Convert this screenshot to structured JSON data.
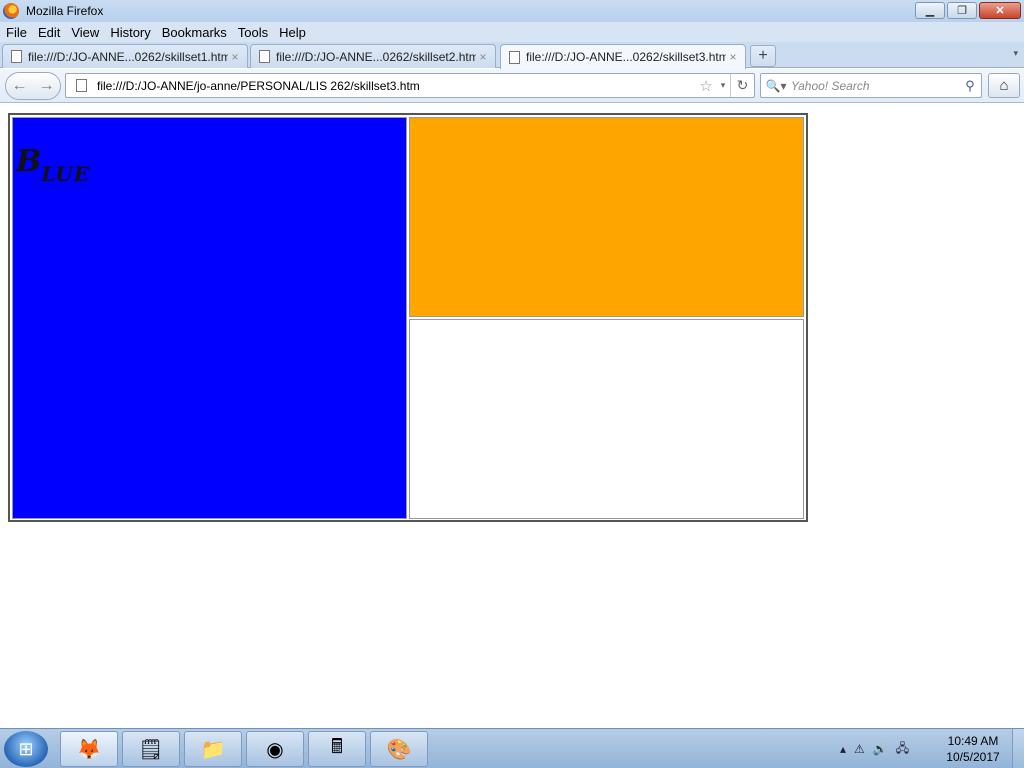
{
  "window": {
    "title": "Mozilla Firefox",
    "controls": {
      "minimize": "▁",
      "maximize": "❐",
      "close": "✕"
    }
  },
  "menu": [
    "File",
    "Edit",
    "View",
    "History",
    "Bookmarks",
    "Tools",
    "Help"
  ],
  "tabs": [
    {
      "label": "file:///D:/JO-ANNE...0262/skillset1.htm",
      "active": false
    },
    {
      "label": "file:///D:/JO-ANNE...0262/skillset2.htm",
      "active": false
    },
    {
      "label": "file:///D:/JO-ANNE...0262/skillset3.htm",
      "active": true
    }
  ],
  "tabstrip": {
    "new_tab": "+",
    "tab_list": "▾",
    "tab_close": "×"
  },
  "nav": {
    "back": "←",
    "forward": "→",
    "url": "file:///D:/JO-ANNE/jo-anne/PERSONAL/LIS 262/skillset3.htm",
    "star": "☆",
    "dropdown": "▾",
    "reload": "↻",
    "search_engine": "🔍▾",
    "search_placeholder": "Yahoo! Search",
    "search_go": "⚲",
    "home": "⌂"
  },
  "page": {
    "blue_label_big": "B",
    "blue_label_small": "LUE",
    "colors": {
      "blue": "#0000ff",
      "orange": "#ffa500",
      "white": "#ffffff"
    }
  },
  "taskbar": {
    "start": "⊞",
    "apps": [
      {
        "name": "firefox",
        "glyph": "🦊"
      },
      {
        "name": "sticky-notes",
        "glyph": "🗒"
      },
      {
        "name": "file-explorer",
        "glyph": "📁"
      },
      {
        "name": "chrome",
        "glyph": "◉"
      },
      {
        "name": "calculator",
        "glyph": "🖩"
      },
      {
        "name": "paint",
        "glyph": "🎨"
      }
    ],
    "tray": {
      "up_arrow": "▴",
      "warning": "⚠",
      "volume": "🔊",
      "network": "🖧"
    },
    "time": "10:49 AM",
    "date": "10/5/2017"
  }
}
